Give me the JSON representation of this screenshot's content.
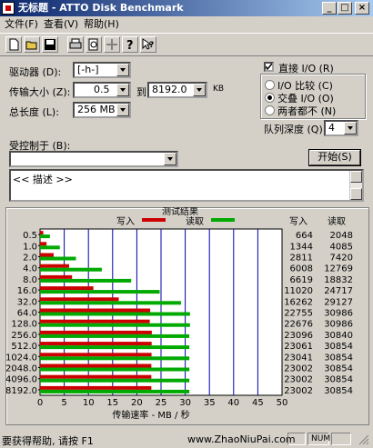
{
  "window": {
    "title": "无标题 - ATTO Disk Benchmark"
  },
  "menu": {
    "file": "文件(F)",
    "view": "查看(V)",
    "help": "帮助(H)"
  },
  "toolbar": {
    "icons": [
      "new-icon",
      "open-icon",
      "save-icon",
      "print-icon",
      "print-preview-icon",
      "move-icon",
      "help-icon",
      "context-help-icon"
    ]
  },
  "form": {
    "drive_label": "驱动器 (D):",
    "drive_value": "[-h-]",
    "transfer_label": "传输大小 (Z):",
    "transfer_from": "0.5",
    "to_label": "到",
    "transfer_to": "8192.0",
    "kb_label": "KB",
    "length_label": "总长度 (L):",
    "length_value": "256 MB",
    "direct_io_label": "直接 I/O (R)",
    "direct_io_checked": true,
    "io_compare_label": "I/O 比较 (C)",
    "overlap_io_label": "交叠 I/O (O)",
    "neither_label": "两者都不 (N)",
    "selected_mode": "overlap",
    "queue_label": "队列深度 (Q):",
    "queue_value": "4",
    "controlled_label": "受控制于 (B):",
    "controlled_value": "",
    "start_button": "开始(S)",
    "description": "<< 描述 >>"
  },
  "results": {
    "title": "测试结果",
    "write_legend": "写入",
    "read_legend": "读取",
    "write_header": "写入",
    "read_header": "读取",
    "xlabel": "传输速率 - MB / 秒",
    "write_color": "#cc0000",
    "read_color": "#00aa00"
  },
  "chart_data": {
    "type": "bar",
    "orientation": "horizontal",
    "title": "测试结果",
    "xlabel": "传输速率 - MB / 秒",
    "categories": [
      "0.5",
      "1.0",
      "2.0",
      "4.0",
      "8.0",
      "16.0",
      "32.0",
      "64.0",
      "128.0",
      "256.0",
      "512.0",
      "1024.0",
      "2048.0",
      "4096.0",
      "8192.0"
    ],
    "xticks": [
      "0",
      "5",
      "10",
      "15",
      "20",
      "25",
      "30",
      "35",
      "40",
      "45",
      "50"
    ],
    "xlim": [
      0,
      50
    ],
    "series": [
      {
        "name": "写入",
        "values": [
          0.664,
          1.344,
          2.811,
          6.008,
          6.619,
          11.02,
          16.262,
          22.755,
          22.676,
          23.096,
          23.061,
          23.041,
          23.002,
          23.002,
          23.002
        ]
      },
      {
        "name": "读取",
        "values": [
          2.048,
          4.085,
          7.42,
          12.769,
          18.832,
          24.717,
          29.127,
          30.986,
          30.986,
          30.84,
          30.854,
          30.854,
          30.854,
          30.854,
          30.854
        ]
      }
    ],
    "write_labels": [
      "664",
      "1344",
      "2811",
      "6008",
      "6619",
      "11020",
      "16262",
      "22755",
      "22676",
      "23096",
      "23061",
      "23041",
      "23002",
      "23002",
      "23002"
    ],
    "read_labels": [
      "2048",
      "4085",
      "7420",
      "12769",
      "18832",
      "24717",
      "29127",
      "30986",
      "30986",
      "30840",
      "30854",
      "30854",
      "30854",
      "30854",
      "30854"
    ],
    "grid": true
  },
  "status": {
    "help": "要获得帮助, 请按 F1",
    "watermark": "www.ZhaoNiuPai.com",
    "num": "NUM"
  }
}
